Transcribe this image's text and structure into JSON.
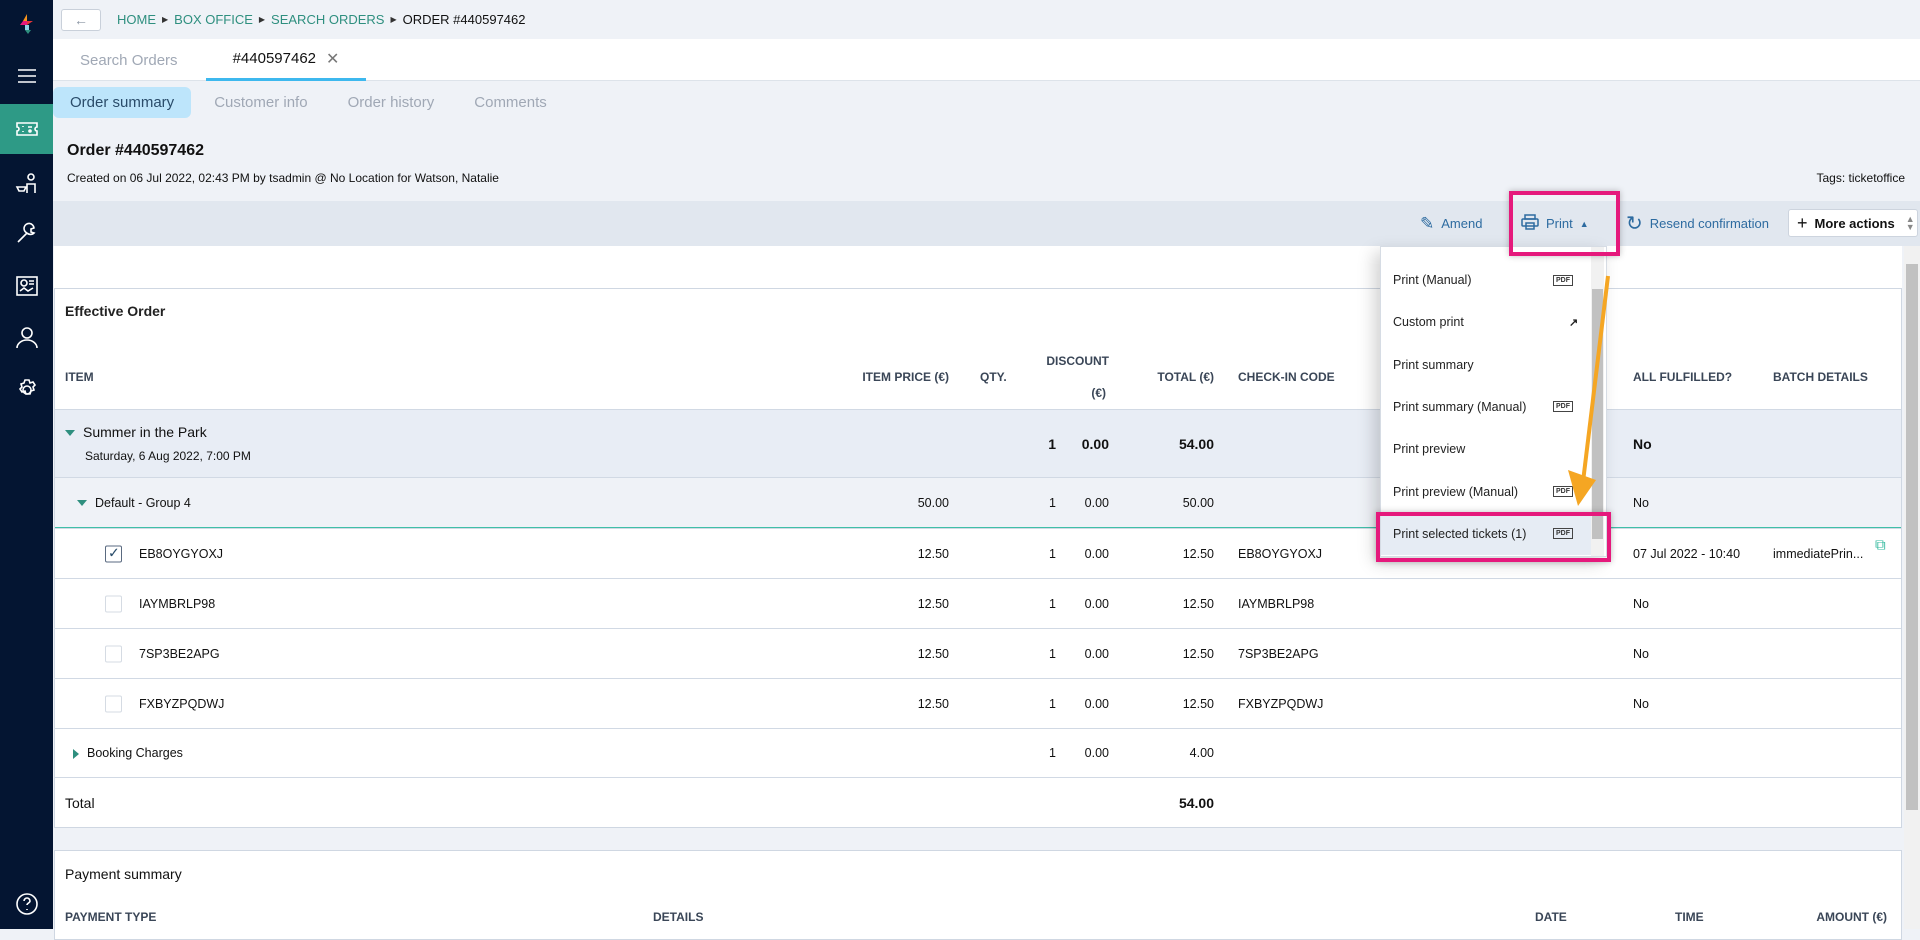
{
  "breadcrumb": [
    "HOME",
    "BOX OFFICE",
    "SEARCH ORDERS",
    "ORDER #440597462"
  ],
  "tabs": {
    "search": "Search Orders",
    "order": "#440597462"
  },
  "subtabs": [
    "Order summary",
    "Customer info",
    "Order history",
    "Comments"
  ],
  "order": {
    "title": "Order #440597462",
    "created": "Created on 06 Jul 2022, 02:43 PM by tsadmin @ No Location for Watson, Natalie",
    "tags": "Tags: ticketoffice"
  },
  "toolbar": {
    "amend": "Amend",
    "print": "Print",
    "resend": "Resend confirmation",
    "more": "More actions"
  },
  "print_menu": [
    {
      "label": "Print (Manual)",
      "badge": "PDF"
    },
    {
      "label": "Custom print",
      "badge": "↗"
    },
    {
      "label": "Print summary",
      "badge": ""
    },
    {
      "label": "Print summary (Manual)",
      "badge": "PDF"
    },
    {
      "label": "Print preview",
      "badge": ""
    },
    {
      "label": "Print preview (Manual)",
      "badge": "PDF"
    },
    {
      "label": "Print selected tickets (1)",
      "badge": "PDF"
    }
  ],
  "effective_order": {
    "title": "Effective Order",
    "headers": {
      "item": "ITEM",
      "price": "ITEM PRICE (€)",
      "qty": "QTY.",
      "discount": "DISCOUNT",
      "discount2": "(€)",
      "total": "TOTAL (€)",
      "checkin": "CHECK-IN CODE",
      "fulfilled": "ALL FULFILLED?",
      "batch": "BATCH DETAILS"
    },
    "event": {
      "name": "Summer in the Park",
      "date": "Saturday, 6 Aug 2022, 7:00 PM",
      "qty": "1",
      "discount": "0.00",
      "total": "54.00",
      "fulfilled": "No"
    },
    "group": {
      "name": "Default - Group 4",
      "price": "50.00",
      "qty": "1",
      "discount": "0.00",
      "total": "50.00",
      "fulfilled": "No"
    },
    "tickets": [
      {
        "code": "EB8OYGYOXJ",
        "price": "12.50",
        "qty": "1",
        "discount": "0.00",
        "total": "12.50",
        "checkin": "EB8OYGYOXJ",
        "fulfilled": "07 Jul 2022 - 10:40",
        "batch": "immediatePrin...",
        "checked": true
      },
      {
        "code": "IAYMBRLP98",
        "price": "12.50",
        "qty": "1",
        "discount": "0.00",
        "total": "12.50",
        "checkin": "IAYMBRLP98",
        "fulfilled": "No",
        "batch": "",
        "checked": false
      },
      {
        "code": "7SP3BE2APG",
        "price": "12.50",
        "qty": "1",
        "discount": "0.00",
        "total": "12.50",
        "checkin": "7SP3BE2APG",
        "fulfilled": "No",
        "batch": "",
        "checked": false
      },
      {
        "code": "FXBYZPQDWJ",
        "price": "12.50",
        "qty": "1",
        "discount": "0.00",
        "total": "12.50",
        "checkin": "FXBYZPQDWJ",
        "fulfilled": "No",
        "batch": "",
        "checked": false
      }
    ],
    "booking": {
      "name": "Booking Charges",
      "qty": "1",
      "discount": "0.00",
      "total": "4.00"
    },
    "total": {
      "label": "Total",
      "value": "54.00"
    }
  },
  "payment": {
    "title": "Payment summary",
    "headers": [
      "PAYMENT TYPE",
      "DETAILS",
      "DATE",
      "TIME",
      "AMOUNT (€)"
    ]
  },
  "colors": {
    "accent": "#2e8f7f",
    "sidebar": "#041532",
    "highlight": "#e5197c",
    "arrow": "#f5a623"
  }
}
